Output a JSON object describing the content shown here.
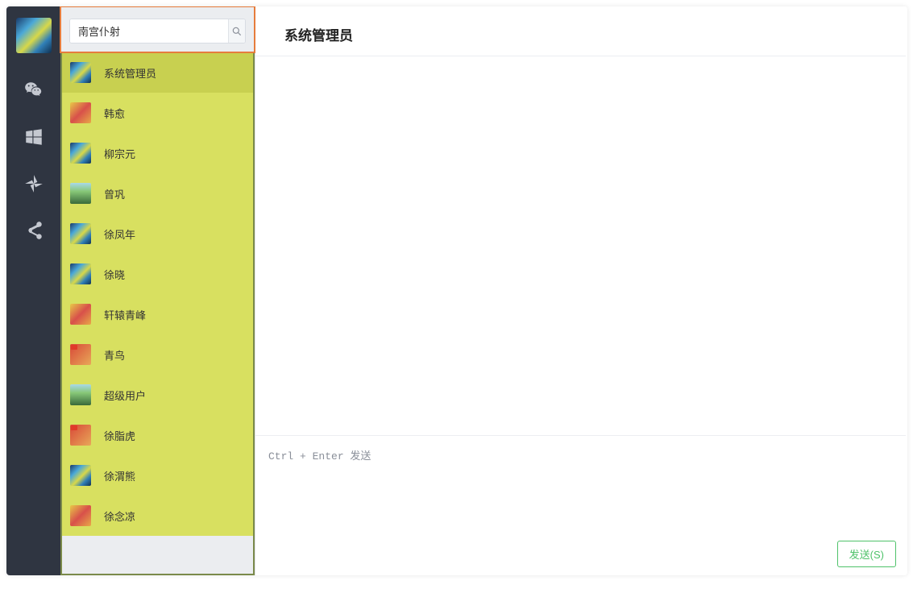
{
  "nav": {
    "icons": [
      "wechat-icon",
      "windows-icon",
      "pinwheel-icon",
      "share-icon"
    ]
  },
  "search": {
    "value": "南宫仆射"
  },
  "contacts": [
    {
      "name": "系统管理员",
      "avatar_class": "av-city",
      "selected": true
    },
    {
      "name": "韩愈",
      "avatar_class": "av-paint",
      "selected": false
    },
    {
      "name": "柳宗元",
      "avatar_class": "av-city",
      "selected": false
    },
    {
      "name": "曾巩",
      "avatar_class": "av-mount",
      "selected": false
    },
    {
      "name": "徐凤年",
      "avatar_class": "av-city",
      "selected": false
    },
    {
      "name": "徐晓",
      "avatar_class": "av-city",
      "selected": false
    },
    {
      "name": "轩辕青峰",
      "avatar_class": "av-paint",
      "selected": false
    },
    {
      "name": "青鸟",
      "avatar_class": "av-red",
      "selected": false
    },
    {
      "name": "超级用户",
      "avatar_class": "av-mount",
      "selected": false
    },
    {
      "name": "徐脂虎",
      "avatar_class": "av-red",
      "selected": false
    },
    {
      "name": "徐渭熊",
      "avatar_class": "av-city",
      "selected": false
    },
    {
      "name": "徐念凉",
      "avatar_class": "av-paint",
      "selected": false
    }
  ],
  "chat": {
    "title": "系统管理员",
    "input_placeholder": "Ctrl + Enter 发送",
    "send_label": "发送(S)"
  }
}
